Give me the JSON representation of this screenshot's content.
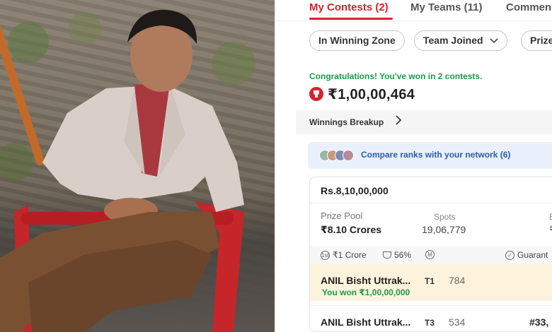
{
  "tabs": [
    {
      "label": "My Contests (2)",
      "active": true
    },
    {
      "label": "My Teams (11)",
      "active": false
    },
    {
      "label": "Commen",
      "active": false
    }
  ],
  "filters": [
    {
      "label": "In Winning Zone"
    },
    {
      "label": "Team Joined",
      "icon": "chevron-down-icon"
    },
    {
      "label": "Prize"
    }
  ],
  "summary": {
    "congrats": "Congratulations! You've won in 2 contests.",
    "amount": "₹1,00,00,464",
    "breakup_label": "Winnings Breakup",
    "network_text": "Compare ranks with your network (6)"
  },
  "contest": {
    "title": "Rs.8,10,00,000",
    "prize_pool_label": "Prize Pool",
    "prize_pool_value": "₹8.10 Crores",
    "spots_label": "Spots",
    "spots_value": "19,06,779",
    "edge_label": "E",
    "edge_value": "₹",
    "first_prize": "₹1 Crore",
    "win_percent": "56%",
    "multi_icon": "M",
    "guarantee": "Guarant",
    "teams": [
      {
        "name": "ANIL Bisht Uttrak...",
        "team": "T1",
        "rank": "784",
        "won": "You won ₹1,00,00,000",
        "right_rank": ""
      },
      {
        "name": "ANIL Bisht Uttrak...",
        "team": "T3",
        "rank": "534",
        "won": "",
        "right_rank": "#33,"
      }
    ]
  },
  "colors": {
    "accent": "#d4242f",
    "success": "#1d9a4a",
    "link": "#2a5dab",
    "highlight_row": "#fdf3dd"
  }
}
